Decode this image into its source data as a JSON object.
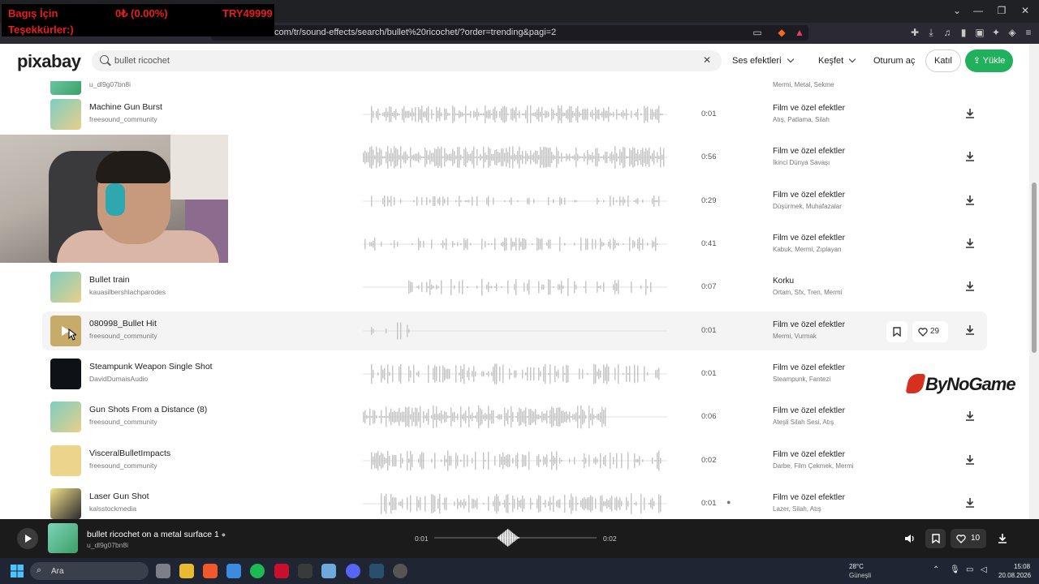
{
  "browser": {
    "url": "com/tr/sound-effects/search/bullet%20ricochet/?order=trending&pagi=2"
  },
  "donation": {
    "line1": "Bagış İçin",
    "line2": "Teşekkürler:)",
    "percent": "0₺ (0.00%)",
    "goal": "TRY49999"
  },
  "header": {
    "logo": "pixabay",
    "search_value": "bullet ricochet",
    "filter_label": "Ses efektleri",
    "explore_label": "Keşfet",
    "login_label": "Oturum aç",
    "join_label": "Katıl",
    "upload_label": "Yükle"
  },
  "list": {
    "rows": [
      {
        "title": "Machine Gun Burst",
        "author": "freesound_community",
        "duration": "0:01",
        "category": "Film ve özel efektler",
        "tags": "Atış, Patlama, Silah"
      },
      {
        "title": "",
        "author": "",
        "duration": "0:56",
        "category": "Film ve özel efektler",
        "tags": "İkinci Dünya Savaşı"
      },
      {
        "title": "",
        "author": "",
        "duration": "0:29",
        "category": "Film ve özel efektler",
        "tags": "Düşürmek, Muhafazalar"
      },
      {
        "title": "",
        "author": "",
        "duration": "0:41",
        "category": "Film ve özel efektler",
        "tags": "Kabuk, Mermi, Zıplayan"
      },
      {
        "title": "Bullet train",
        "author": "kauasilbershlachparodes",
        "duration": "0:07",
        "category": "Korku",
        "tags": "Ortam, Sfx, Tren, Mermi"
      },
      {
        "title": "080998_Bullet Hit",
        "author": "freesound_community",
        "duration": "0:01",
        "category": "Film ve özel efektler",
        "tags": "Mermi, Vurmak",
        "likes": "29"
      },
      {
        "title": "Steampunk Weapon Single Shot",
        "author": "DavidDumaisAudio",
        "duration": "0:01",
        "category": "Film ve özel efektler",
        "tags": "Steampunk, Fantezi"
      },
      {
        "title": "Gun Shots From a Distance (8)",
        "author": "freesound_community",
        "duration": "0:06",
        "category": "Film ve özel efektler",
        "tags": "Ateşli Silah Sesi, Atış"
      },
      {
        "title": "VisceralBulletImpacts",
        "author": "freesound_community",
        "duration": "0:02",
        "category": "Film ve özel efektler",
        "tags": "Darbe, Film Çekmek, Mermi"
      },
      {
        "title": "Laser Gun Shot",
        "author": "kalsstockmedia",
        "duration": "0:01",
        "category": "Film ve özel efektler",
        "tags": "Lazer, Silah, Atış"
      }
    ],
    "partial_top": {
      "author": "u_dl9g07bn8i",
      "tags": "Mermi, Metal, Sekme"
    }
  },
  "player": {
    "title": "bullet ricochet on a metal surface 1",
    "author": "u_dl9g07bn8i",
    "current_time": "0:01",
    "total_time": "0:02",
    "likes": "10"
  },
  "watermark": "ByNoGame",
  "taskbar": {
    "search_placeholder": "Ara",
    "weather_temp": "28°C",
    "weather_desc": "Güneşli",
    "time": "15:08",
    "date": "20.08.2026"
  },
  "colors": {
    "accent": "#21b15c",
    "player_bg": "#1b1b1b",
    "donation_text": "#e81d1d"
  }
}
